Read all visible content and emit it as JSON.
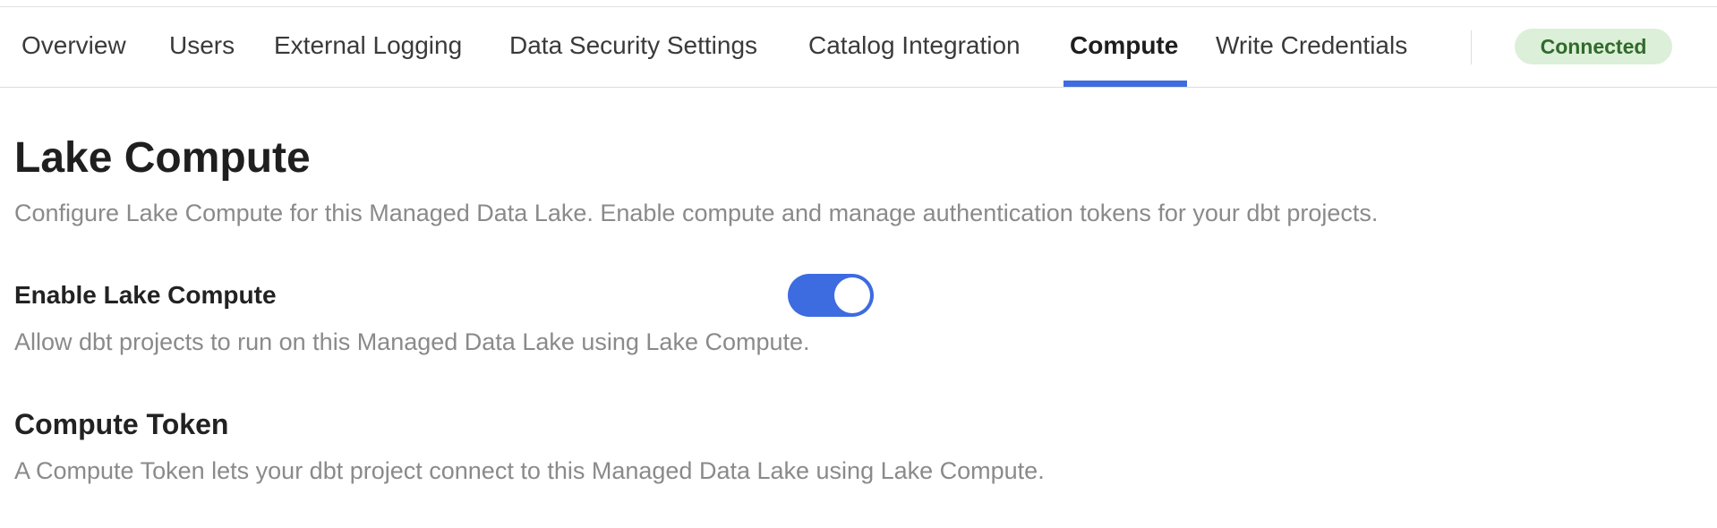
{
  "tabs": [
    {
      "label": "Overview"
    },
    {
      "label": "Users"
    },
    {
      "label": "External Logging"
    },
    {
      "label": "Data Security Settings"
    },
    {
      "label": "Catalog Integration"
    },
    {
      "label": "Compute"
    },
    {
      "label": "Write Credentials"
    }
  ],
  "active_tab": "Compute",
  "status": {
    "label": "Connected",
    "color": "#2f6b2a",
    "background": "#dcefd8"
  },
  "accent_color": "#3d6be0",
  "page": {
    "title": "Lake Compute",
    "description": "Configure Lake Compute for this Managed Data Lake. Enable compute and manage authentication tokens for your dbt projects."
  },
  "enable_compute": {
    "label": "Enable Lake Compute",
    "description": "Allow dbt projects to run on this Managed Data Lake using Lake Compute.",
    "enabled": true
  },
  "compute_token": {
    "title": "Compute Token",
    "description": "A Compute Token lets your dbt project connect to this Managed Data Lake using Lake Compute."
  }
}
